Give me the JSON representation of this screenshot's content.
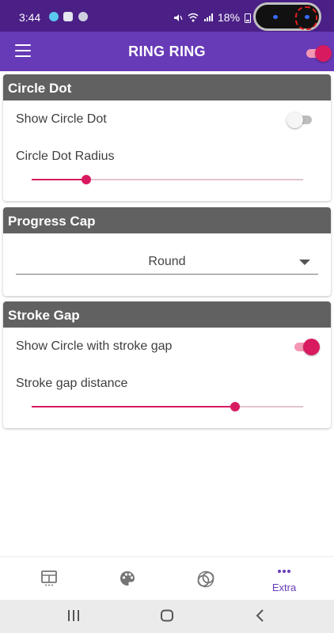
{
  "status_bar": {
    "time": "3:44",
    "battery": "18%"
  },
  "app_bar": {
    "title": "RING RING",
    "menu_icon": "menu-icon",
    "toggle_on": true
  },
  "circle_dot": {
    "header": "Circle Dot",
    "show_label": "Show Circle Dot",
    "show_enabled": false,
    "radius_label": "Circle Dot Radius",
    "radius_fraction": 0.2
  },
  "progress_cap": {
    "header": "Progress Cap",
    "selected": "Round"
  },
  "stroke_gap": {
    "header": "Stroke Gap",
    "show_label": "Show Circle with stroke gap",
    "show_enabled": true,
    "distance_label": "Stroke gap distance",
    "distance_fraction": 0.75
  },
  "bottom_nav": {
    "items": [
      {
        "icon": "grid-table-icon",
        "label": ""
      },
      {
        "icon": "palette-icon",
        "label": ""
      },
      {
        "icon": "rings-icon",
        "label": ""
      },
      {
        "icon": "more-dots-icon",
        "label": "Extra",
        "active": true
      }
    ]
  },
  "colors": {
    "primary": "#673ab7",
    "status_bar": "#4a1f86",
    "accent": "#d81b60",
    "card_header": "#616161"
  }
}
